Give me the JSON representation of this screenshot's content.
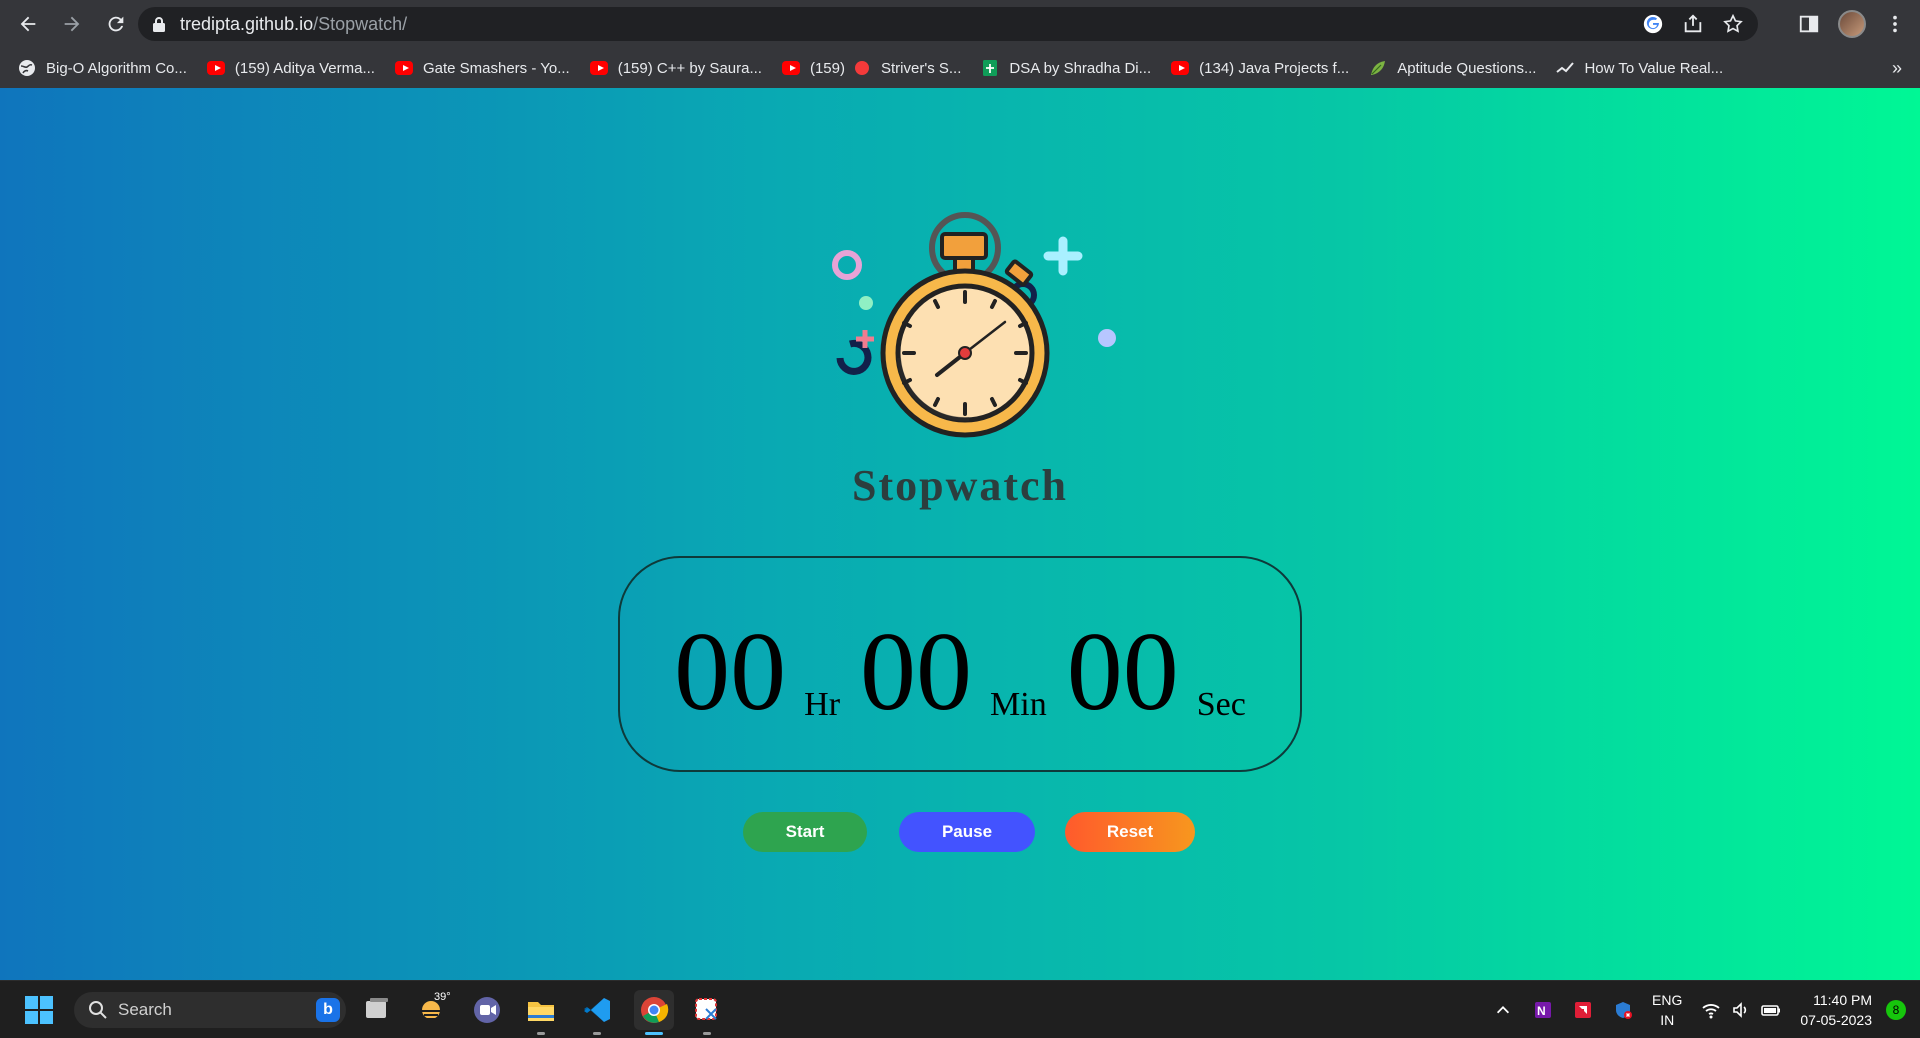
{
  "browser": {
    "url_host": "tredipta.github.io",
    "url_path": "/Stopwatch/",
    "bookmarks": [
      {
        "label": "Big-O Algorithm Co...",
        "icon": "globe-icon"
      },
      {
        "label": "(159) Aditya Verma...",
        "icon": "youtube-icon"
      },
      {
        "label": "Gate Smashers - Yo...",
        "icon": "youtube-icon"
      },
      {
        "label": "(159) C++ by Saura...",
        "icon": "youtube-icon"
      },
      {
        "label": "(159)",
        "icon": "youtube-icon"
      },
      {
        "label": "Striver's S...",
        "icon": "red-dot-icon"
      },
      {
        "label": "DSA by Shradha Di...",
        "icon": "sheets-icon"
      },
      {
        "label": "(134) Java Projects f...",
        "icon": "youtube-icon"
      },
      {
        "label": "Aptitude Questions...",
        "icon": "leaf-icon"
      },
      {
        "label": "How To Value Real...",
        "icon": "chart-icon"
      }
    ],
    "more": "»"
  },
  "page": {
    "title": "Stopwatch",
    "hours": "00",
    "hours_unit": "Hr",
    "minutes": "00",
    "minutes_unit": "Min",
    "seconds": "00",
    "seconds_unit": "Sec",
    "start_label": "Start",
    "pause_label": "Pause",
    "reset_label": "Reset"
  },
  "taskbar": {
    "search_placeholder": "Search",
    "weather_temp": "39°",
    "lang_line1": "ENG",
    "lang_line2": "IN",
    "time": "11:40 PM",
    "date": "07-05-2023",
    "notification_count": "8"
  },
  "colors": {
    "start": "#2ea44f",
    "pause": "#4353ff",
    "reset": "#ff5a2c"
  }
}
